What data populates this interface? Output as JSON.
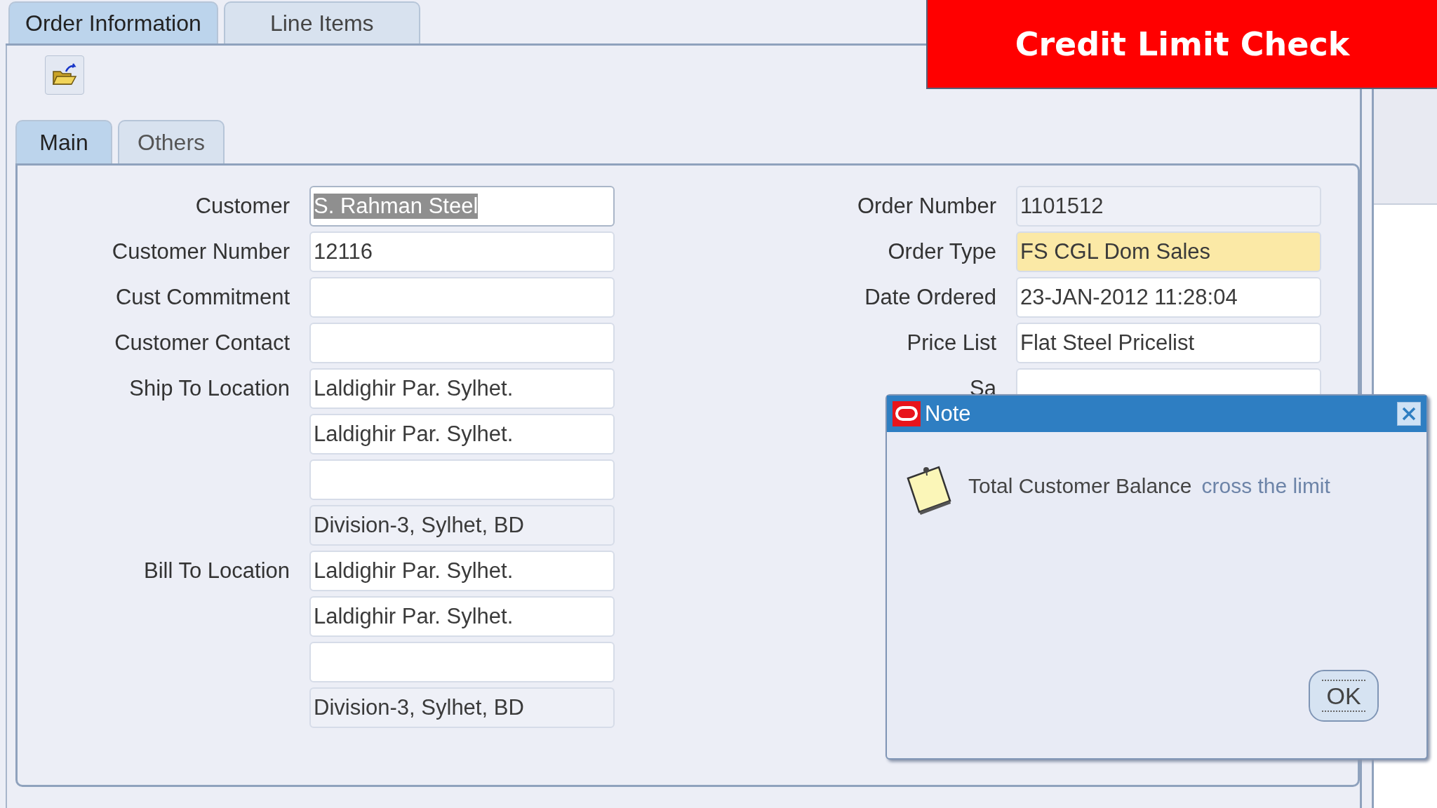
{
  "tabs": [
    {
      "label": "Order Information",
      "selected": true
    },
    {
      "label": "Line Items",
      "selected": false
    }
  ],
  "subtabs": [
    {
      "label": "Main",
      "selected": true
    },
    {
      "label": "Others",
      "selected": false
    }
  ],
  "left_fields": [
    {
      "label": "Customer",
      "value": "S. Rahman Steel",
      "kind": "text",
      "highlighted": true
    },
    {
      "label": "Customer Number",
      "value": "12116",
      "kind": "text",
      "highlighted": false
    },
    {
      "label": "Cust Commitment",
      "kind": "text",
      "highlighted": false
    },
    {
      "label": "Customer Contact",
      "kind": "text",
      "highlighted": false
    },
    {
      "label": "Ship To Location",
      "value": "Laldighir Par. Sylhet.",
      "kind": "text",
      "highlighted": false
    },
    {
      "value": "Laldighir Par. Sylhet.",
      "kind": "text",
      "highlighted": false
    },
    {
      "kind": "text",
      "highlighted": false
    },
    {
      "value": "Division-3, Sylhet, BD",
      "kind": "readonly",
      "highlighted": false
    },
    {
      "label": "Bill To Location",
      "value": "Laldighir Par. Sylhet.",
      "kind": "text",
      "highlighted": false
    },
    {
      "value": "Laldighir Par. Sylhet.",
      "kind": "text",
      "highlighted": false
    },
    {
      "kind": "text",
      "highlighted": false
    },
    {
      "value": "Division-3, Sylhet, BD",
      "kind": "readonly",
      "highlighted": false
    }
  ],
  "right_fields": [
    {
      "label": "Order Number",
      "value": "1101512",
      "kind": "readonly",
      "highlighted": false
    },
    {
      "label": "Order Type",
      "value": "FS CGL Dom Sales",
      "kind": "required",
      "highlighted": false
    },
    {
      "label": "Date Ordered",
      "value": "23-JAN-2012 11:28:04",
      "kind": "text",
      "highlighted": false
    },
    {
      "label": "Price List",
      "value": "Flat Steel Pricelist",
      "kind": "text",
      "highlighted": false
    },
    {
      "label": "Sa",
      "kind": "text",
      "highlighted": false
    }
  ],
  "dialog": {
    "title": "Note",
    "message": "Total Customer Balance",
    "message_highlight": "cross the limit",
    "button": "OK"
  },
  "banner": {
    "text": "Credit Limit Check"
  }
}
